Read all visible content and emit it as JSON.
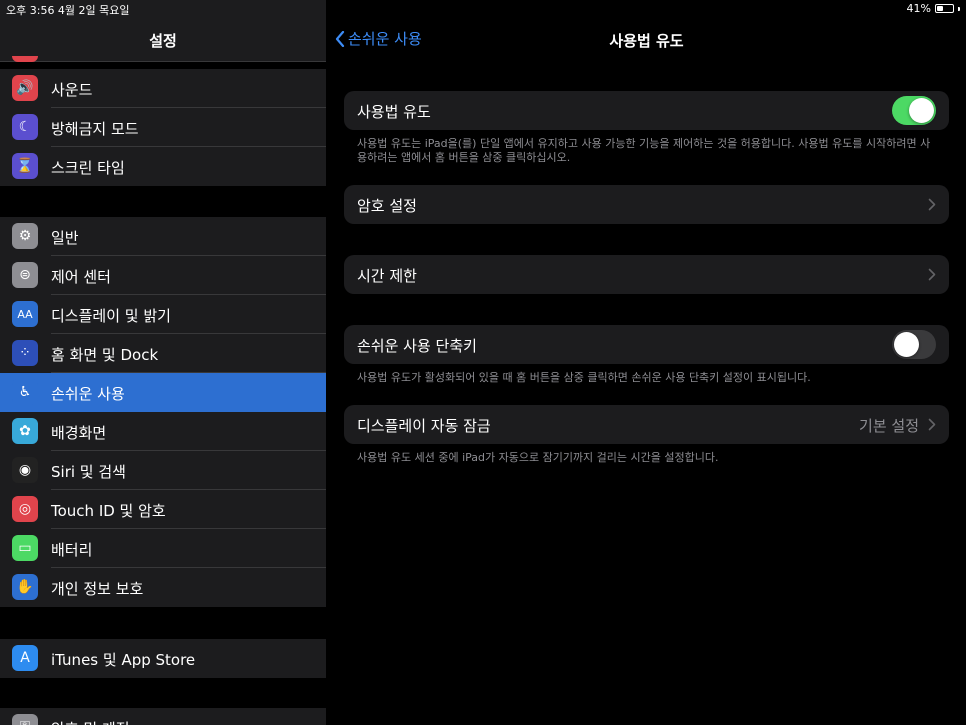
{
  "status_bar": {
    "time_date": "오후 3:56   4월 2일 목요일",
    "battery_pct": "41%",
    "battery_level": 0.41
  },
  "sidebar": {
    "title": "설정",
    "groups": [
      {
        "items": [
          {
            "label": "사운드",
            "icon": "speaker-icon",
            "color": "#e0444c",
            "glyph": "🔊"
          },
          {
            "label": "방해금지 모드",
            "icon": "moon-icon",
            "color": "#5b4fcf",
            "glyph": "☾"
          },
          {
            "label": "스크린 타임",
            "icon": "hourglass-icon",
            "color": "#5b4fcf",
            "glyph": "⌛"
          }
        ]
      },
      {
        "items": [
          {
            "label": "일반",
            "icon": "gear-icon",
            "color": "#8e8e93",
            "glyph": "⚙"
          },
          {
            "label": "제어 센터",
            "icon": "toggles-icon",
            "color": "#8e8e93",
            "glyph": "⊜"
          },
          {
            "label": "디스플레이 및 밝기",
            "icon": "text-size-icon",
            "color": "#2d6fd1",
            "glyph": "AA"
          },
          {
            "label": "홈 화면 및 Dock",
            "icon": "home-grid-icon",
            "color": "#2d4fb8",
            "glyph": "⁘"
          },
          {
            "label": "손쉬운 사용",
            "icon": "accessibility-icon",
            "color": "#2d6fd1",
            "glyph": "♿",
            "selected": true
          },
          {
            "label": "배경화면",
            "icon": "flower-icon",
            "color": "#38a9d9",
            "glyph": "✿"
          },
          {
            "label": "Siri 및 검색",
            "icon": "siri-icon",
            "color": "#222222",
            "glyph": "◉"
          },
          {
            "label": "Touch ID 및 암호",
            "icon": "fingerprint-icon",
            "color": "#e0444c",
            "glyph": "◎"
          },
          {
            "label": "배터리",
            "icon": "battery-icon",
            "color": "#4cd964",
            "glyph": "▭"
          },
          {
            "label": "개인 정보 보호",
            "icon": "hand-icon",
            "color": "#2d6fd1",
            "glyph": "✋"
          }
        ]
      },
      {
        "items": [
          {
            "label": "iTunes 및 App Store",
            "icon": "app-store-icon",
            "color": "#2d8cf0",
            "glyph": "A"
          }
        ]
      },
      {
        "items": [
          {
            "label": "암호 및 계정",
            "icon": "key-icon",
            "color": "#8e8e93",
            "glyph": "⚿"
          }
        ]
      }
    ]
  },
  "main": {
    "back_label": "손쉬운 사용",
    "title": "사용법 유도",
    "guided_access": {
      "label": "사용법 유도",
      "on": true
    },
    "guided_access_footer": "사용법 유도는 iPad을(를) 단일 앱에서 유지하고 사용 가능한 기능을 제어하는 것을 허용합니다. 사용법 유도를 시작하려면 사용하려는 앱에서 홈 버튼을 삼중 클릭하십시오.",
    "passcode_settings": "암호 설정",
    "time_limits": "시간 제한",
    "accessibility_shortcut": {
      "label": "손쉬운 사용 단축키",
      "on": false
    },
    "shortcut_footer": "사용법 유도가 활성화되어 있을 때 홈 버튼을 삼중 클릭하면 손쉬운 사용 단축키 설정이 표시됩니다.",
    "display_auto_lock": {
      "label": "디스플레이 자동 잠금",
      "value": "기본 설정"
    },
    "auto_lock_footer": "사용법 유도 세션 중에 iPad가 자동으로 잠기기까지 걸리는 시간을 설정합니다."
  },
  "colors": {
    "accent": "#3d8cf6",
    "toggle_on": "#4cd964",
    "selected": "#2d6fd1"
  }
}
